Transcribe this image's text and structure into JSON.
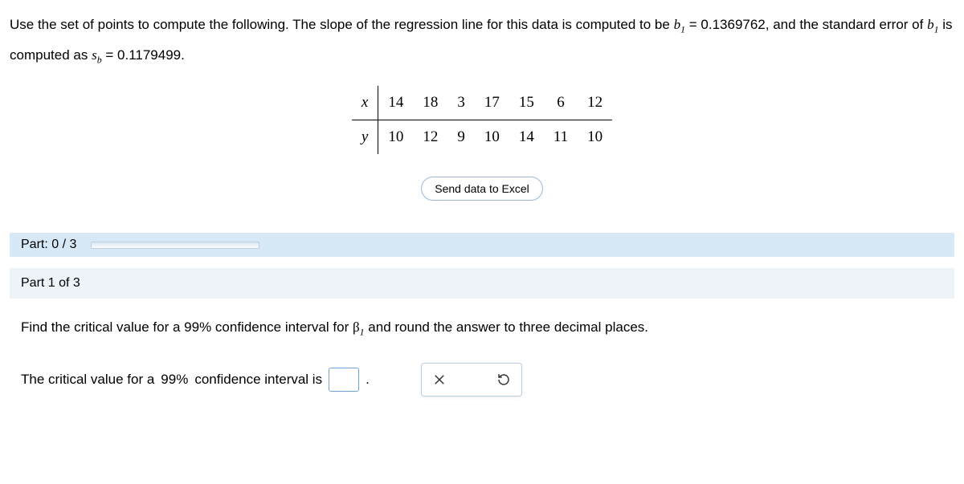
{
  "question": {
    "prefix": "Use the set of points to compute the following. The slope of the regression line for this data is computed to be ",
    "b1_value": "0.1369762",
    "middle": ", and the standard error of ",
    "suffix": " is computed as ",
    "sb_value": "0.1179499",
    "end": "."
  },
  "table": {
    "row1_label": "x",
    "row2_label": "y",
    "x": [
      "14",
      "18",
      "3",
      "17",
      "15",
      "6",
      "12"
    ],
    "y": [
      "10",
      "12",
      "9",
      "10",
      "14",
      "11",
      "10"
    ]
  },
  "excel_button": "Send data to Excel",
  "progress": {
    "label": "Part: 0 / 3"
  },
  "part1": {
    "header": "Part 1 of 3",
    "prompt_before": "Find the critical value for a ",
    "confidence": "99%",
    "prompt_mid": " confidence interval for ",
    "prompt_after": " and round the answer to three decimal places.",
    "answer_before": "The critical value for a ",
    "answer_after": " confidence interval is ",
    "answer_end": "."
  }
}
